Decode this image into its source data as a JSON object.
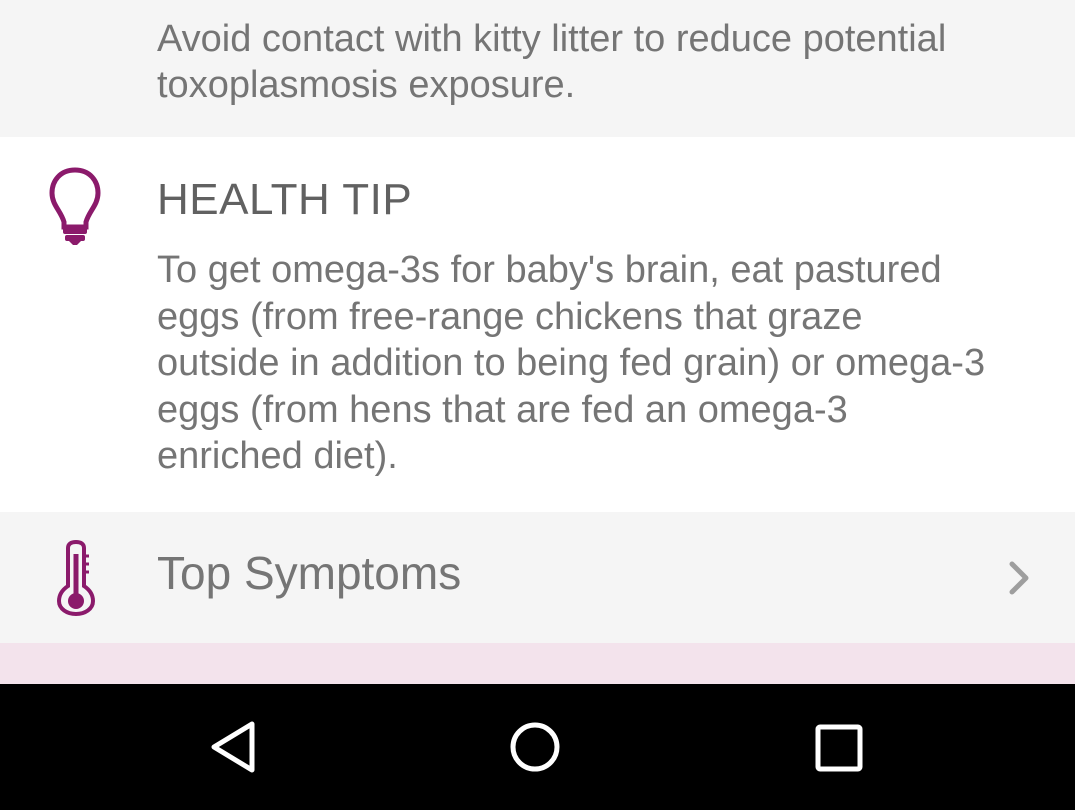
{
  "top_card": {
    "text": "Avoid contact with kitty litter to reduce potential toxoplasmosis exposure."
  },
  "health_tip": {
    "icon": "lightbulb-icon",
    "title": "HEALTH TIP",
    "text": "To get omega-3s for baby's brain, eat pastured eggs (from free-range chickens that graze outside in addition to being fed grain) or omega-3 eggs (from hens that are fed an omega-3 enriched diet)."
  },
  "symptoms_row": {
    "icon": "thermometer-icon",
    "label": "Top Symptoms",
    "chevron": "chevron-right-icon"
  },
  "nav_bar": {
    "back_icon": "back-icon",
    "home_icon": "home-icon",
    "recents_icon": "recents-icon"
  },
  "colors": {
    "accent": "#8b1a6b",
    "text": "#757575",
    "card_gray": "#f5f5f5",
    "strip_pink": "#f3e3ec",
    "nav_bg": "#000000"
  }
}
